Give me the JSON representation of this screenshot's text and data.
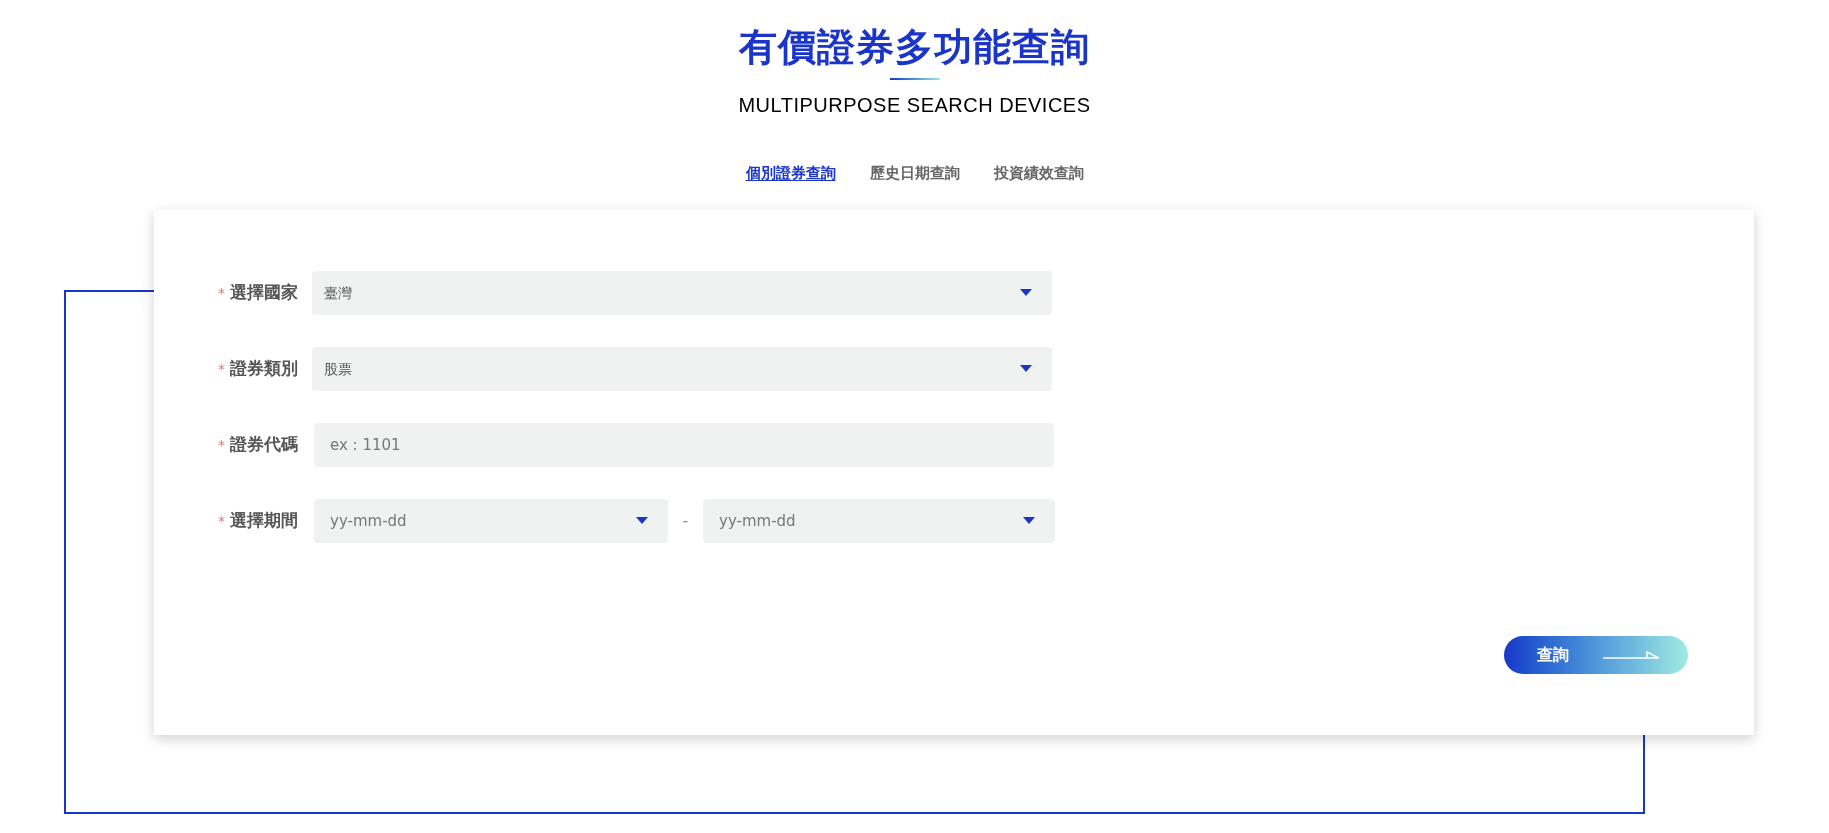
{
  "header": {
    "title": "有價證券多功能查詢",
    "subtitle": "MULTIPURPOSE SEARCH DEVICES"
  },
  "tabs": [
    {
      "label": "個別證券查詢",
      "selected": true
    },
    {
      "label": "歷史日期查詢",
      "selected": false
    },
    {
      "label": "投資績效查詢",
      "selected": false
    }
  ],
  "form": {
    "required_mark": "*",
    "fields": [
      {
        "kind": "select",
        "label": "選擇國家",
        "value": "臺灣"
      },
      {
        "kind": "select",
        "label": "證券類別",
        "value": "股票"
      },
      {
        "kind": "text",
        "label": "證券代碼",
        "placeholder": "ex : 1101"
      },
      {
        "kind": "range",
        "label": "選擇期間",
        "from_placeholder": "yy-mm-dd",
        "separator": "-",
        "to_placeholder": "yy-mm-dd"
      }
    ]
  },
  "submit_button": "查詢"
}
